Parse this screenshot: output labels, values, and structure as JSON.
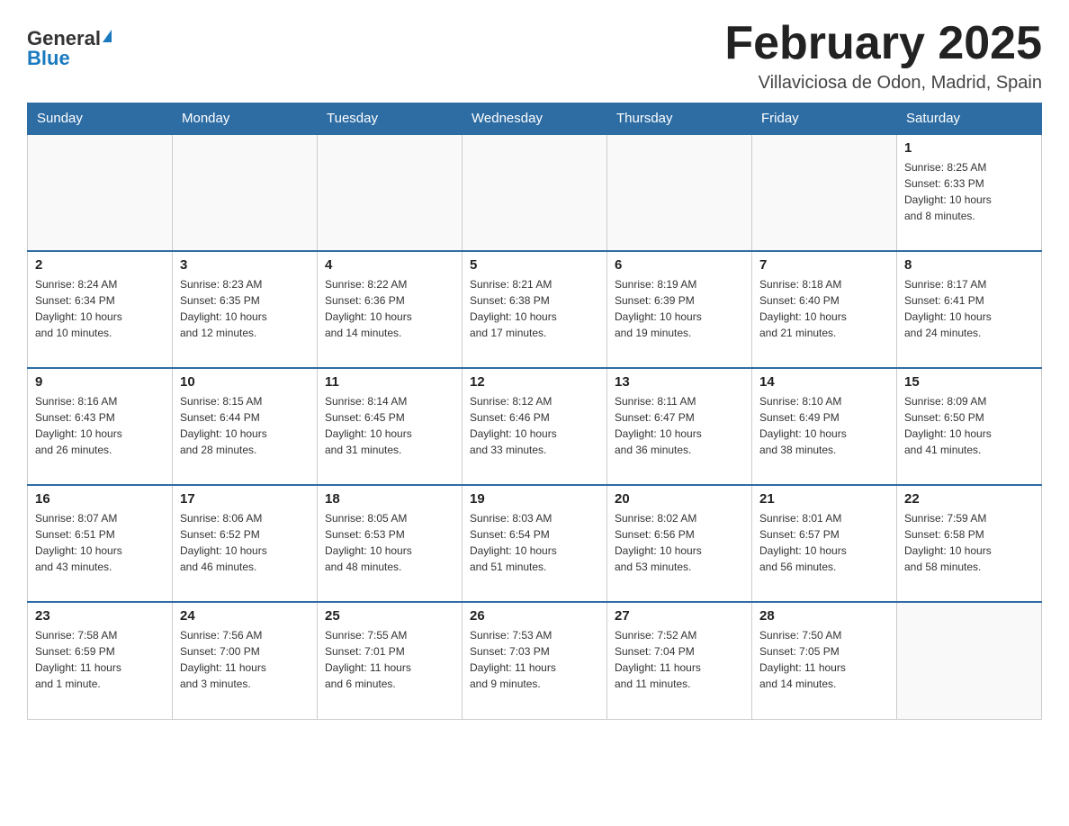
{
  "header": {
    "logo_general": "General",
    "logo_blue": "Blue",
    "month_title": "February 2025",
    "location": "Villaviciosa de Odon, Madrid, Spain"
  },
  "days_of_week": [
    "Sunday",
    "Monday",
    "Tuesday",
    "Wednesday",
    "Thursday",
    "Friday",
    "Saturday"
  ],
  "weeks": [
    [
      {
        "day": "",
        "info": ""
      },
      {
        "day": "",
        "info": ""
      },
      {
        "day": "",
        "info": ""
      },
      {
        "day": "",
        "info": ""
      },
      {
        "day": "",
        "info": ""
      },
      {
        "day": "",
        "info": ""
      },
      {
        "day": "1",
        "info": "Sunrise: 8:25 AM\nSunset: 6:33 PM\nDaylight: 10 hours\nand 8 minutes."
      }
    ],
    [
      {
        "day": "2",
        "info": "Sunrise: 8:24 AM\nSunset: 6:34 PM\nDaylight: 10 hours\nand 10 minutes."
      },
      {
        "day": "3",
        "info": "Sunrise: 8:23 AM\nSunset: 6:35 PM\nDaylight: 10 hours\nand 12 minutes."
      },
      {
        "day": "4",
        "info": "Sunrise: 8:22 AM\nSunset: 6:36 PM\nDaylight: 10 hours\nand 14 minutes."
      },
      {
        "day": "5",
        "info": "Sunrise: 8:21 AM\nSunset: 6:38 PM\nDaylight: 10 hours\nand 17 minutes."
      },
      {
        "day": "6",
        "info": "Sunrise: 8:19 AM\nSunset: 6:39 PM\nDaylight: 10 hours\nand 19 minutes."
      },
      {
        "day": "7",
        "info": "Sunrise: 8:18 AM\nSunset: 6:40 PM\nDaylight: 10 hours\nand 21 minutes."
      },
      {
        "day": "8",
        "info": "Sunrise: 8:17 AM\nSunset: 6:41 PM\nDaylight: 10 hours\nand 24 minutes."
      }
    ],
    [
      {
        "day": "9",
        "info": "Sunrise: 8:16 AM\nSunset: 6:43 PM\nDaylight: 10 hours\nand 26 minutes."
      },
      {
        "day": "10",
        "info": "Sunrise: 8:15 AM\nSunset: 6:44 PM\nDaylight: 10 hours\nand 28 minutes."
      },
      {
        "day": "11",
        "info": "Sunrise: 8:14 AM\nSunset: 6:45 PM\nDaylight: 10 hours\nand 31 minutes."
      },
      {
        "day": "12",
        "info": "Sunrise: 8:12 AM\nSunset: 6:46 PM\nDaylight: 10 hours\nand 33 minutes."
      },
      {
        "day": "13",
        "info": "Sunrise: 8:11 AM\nSunset: 6:47 PM\nDaylight: 10 hours\nand 36 minutes."
      },
      {
        "day": "14",
        "info": "Sunrise: 8:10 AM\nSunset: 6:49 PM\nDaylight: 10 hours\nand 38 minutes."
      },
      {
        "day": "15",
        "info": "Sunrise: 8:09 AM\nSunset: 6:50 PM\nDaylight: 10 hours\nand 41 minutes."
      }
    ],
    [
      {
        "day": "16",
        "info": "Sunrise: 8:07 AM\nSunset: 6:51 PM\nDaylight: 10 hours\nand 43 minutes."
      },
      {
        "day": "17",
        "info": "Sunrise: 8:06 AM\nSunset: 6:52 PM\nDaylight: 10 hours\nand 46 minutes."
      },
      {
        "day": "18",
        "info": "Sunrise: 8:05 AM\nSunset: 6:53 PM\nDaylight: 10 hours\nand 48 minutes."
      },
      {
        "day": "19",
        "info": "Sunrise: 8:03 AM\nSunset: 6:54 PM\nDaylight: 10 hours\nand 51 minutes."
      },
      {
        "day": "20",
        "info": "Sunrise: 8:02 AM\nSunset: 6:56 PM\nDaylight: 10 hours\nand 53 minutes."
      },
      {
        "day": "21",
        "info": "Sunrise: 8:01 AM\nSunset: 6:57 PM\nDaylight: 10 hours\nand 56 minutes."
      },
      {
        "day": "22",
        "info": "Sunrise: 7:59 AM\nSunset: 6:58 PM\nDaylight: 10 hours\nand 58 minutes."
      }
    ],
    [
      {
        "day": "23",
        "info": "Sunrise: 7:58 AM\nSunset: 6:59 PM\nDaylight: 11 hours\nand 1 minute."
      },
      {
        "day": "24",
        "info": "Sunrise: 7:56 AM\nSunset: 7:00 PM\nDaylight: 11 hours\nand 3 minutes."
      },
      {
        "day": "25",
        "info": "Sunrise: 7:55 AM\nSunset: 7:01 PM\nDaylight: 11 hours\nand 6 minutes."
      },
      {
        "day": "26",
        "info": "Sunrise: 7:53 AM\nSunset: 7:03 PM\nDaylight: 11 hours\nand 9 minutes."
      },
      {
        "day": "27",
        "info": "Sunrise: 7:52 AM\nSunset: 7:04 PM\nDaylight: 11 hours\nand 11 minutes."
      },
      {
        "day": "28",
        "info": "Sunrise: 7:50 AM\nSunset: 7:05 PM\nDaylight: 11 hours\nand 14 minutes."
      },
      {
        "day": "",
        "info": ""
      }
    ]
  ]
}
